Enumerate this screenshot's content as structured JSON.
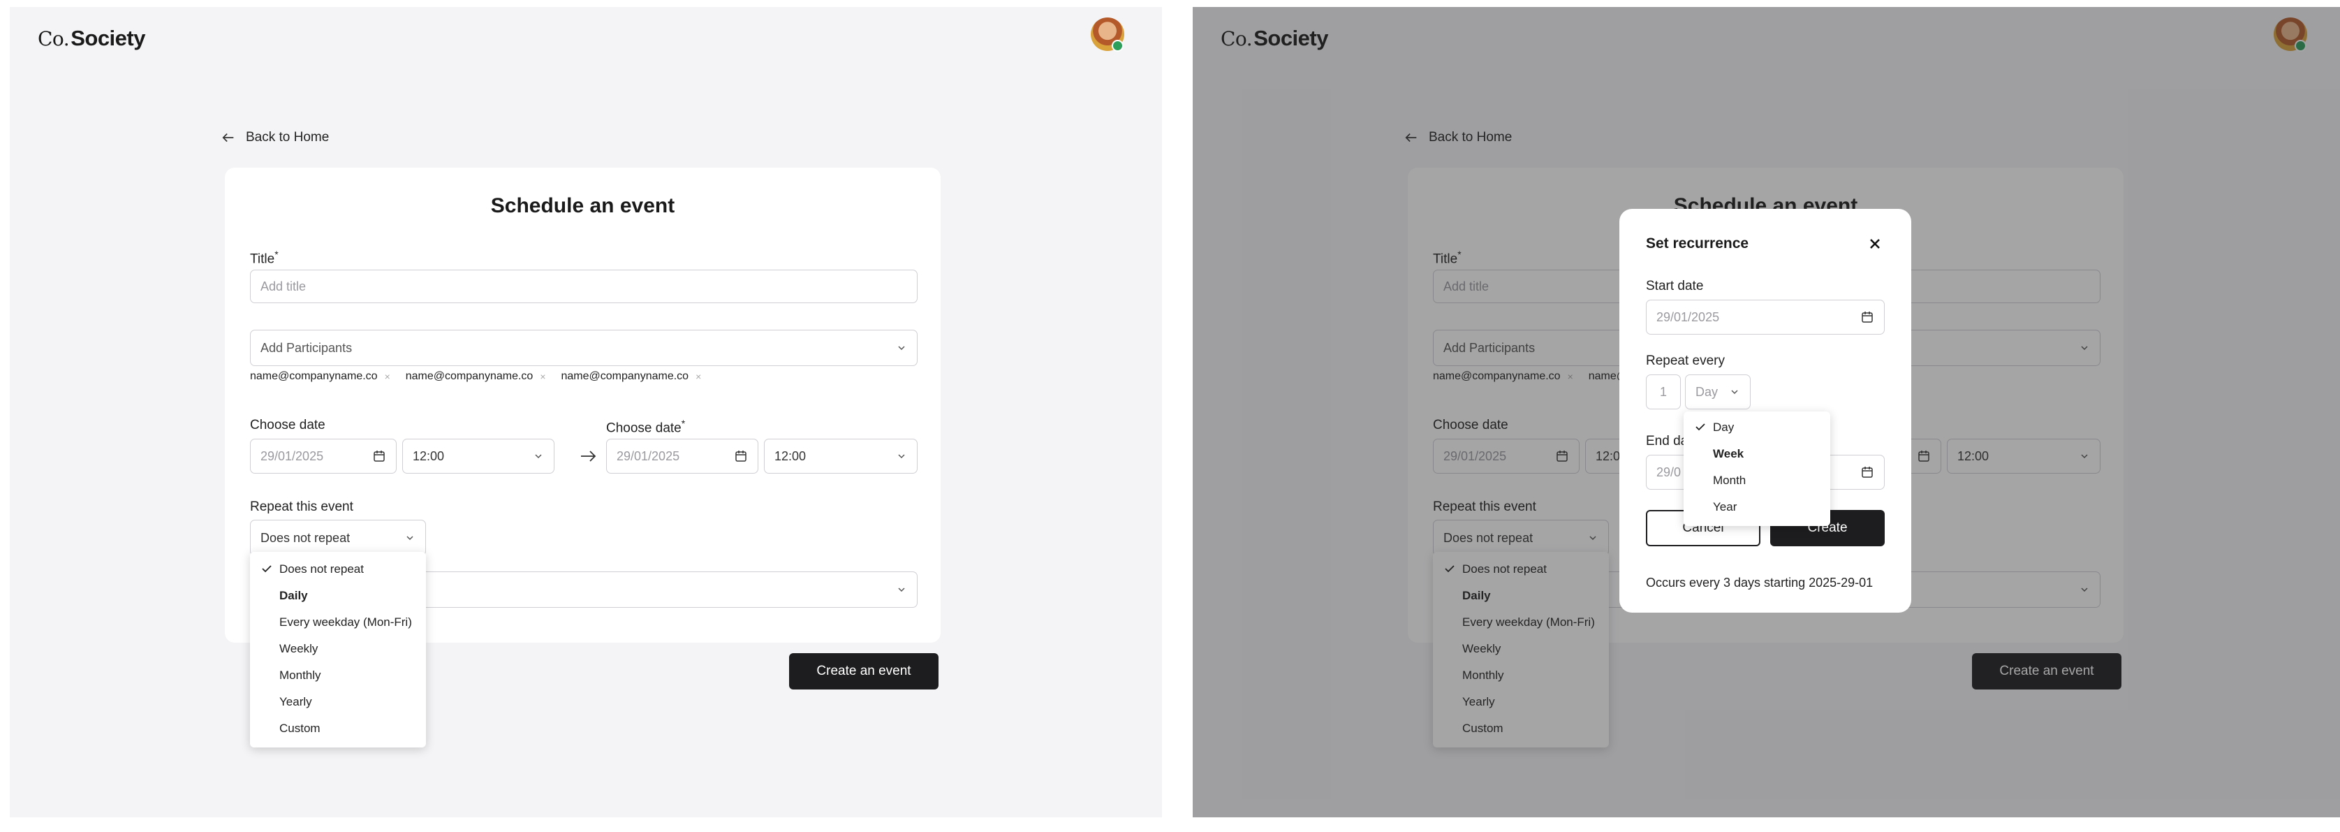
{
  "brand": {
    "co": "Co.",
    "name": "Society"
  },
  "back": {
    "label": "Back to Home"
  },
  "form": {
    "title": "Schedule an event",
    "title_label": "Title",
    "title_placeholder": "Add title",
    "participants_placeholder": "Add Participants",
    "chips": [
      "name@companyname.co",
      "name@companyname.co",
      "name@companyname.co"
    ],
    "chip_remove": "×",
    "start": {
      "label": "Choose date",
      "date": "29/01/2025",
      "time": "12:00"
    },
    "end": {
      "label": "Choose date",
      "date": "29/01/2025",
      "time": "12:00"
    },
    "required_mark": "*",
    "repeat_label": "Repeat this event",
    "repeat_value": "Does not repeat",
    "repeat_options": [
      "Does not repeat",
      "Daily",
      "Every weekday (Mon-Fri)",
      "Weekly",
      "Monthly",
      "Yearly",
      "Custom"
    ],
    "submit": "Create an event"
  },
  "modal": {
    "title": "Set recurrence",
    "start_label": "Start date",
    "start_date": "29/01/2025",
    "repeat_label": "Repeat every",
    "repeat_count": "1",
    "repeat_unit": "Day",
    "unit_options": [
      "Day",
      "Week",
      "Month",
      "Year"
    ],
    "end_label": "End da",
    "end_date": "29/0",
    "cancel": "Cancel",
    "create": "Create",
    "summary": "Occurs every 3 days starting 2025-29-01"
  },
  "colors": {
    "primary": "#1d1d1f",
    "background": "#f4f4f6",
    "overlay": "#8d8d8f",
    "online": "#2e9e5b"
  }
}
